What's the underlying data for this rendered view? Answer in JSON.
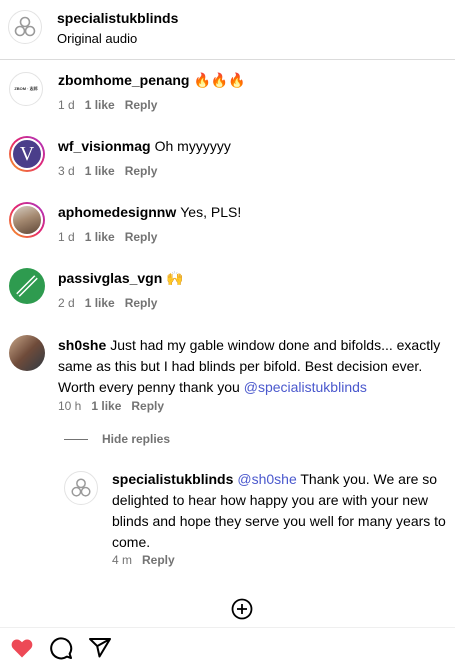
{
  "header": {
    "username": "specialistukblinds",
    "subtitle": "Original audio"
  },
  "comments": [
    {
      "username": "zbomhome_penang",
      "text": "🔥🔥🔥",
      "time": "1 d",
      "likes": "1 like",
      "reply": "Reply",
      "avatar_text": "ZBOM · 志邦"
    },
    {
      "username": "wf_visionmag",
      "text": "Oh myyyyyy",
      "time": "3 d",
      "likes": "1 like",
      "reply": "Reply",
      "avatar_text": "V"
    },
    {
      "username": "aphomedesignnw",
      "text": "Yes, PLS!",
      "time": "1 d",
      "likes": "1 like",
      "reply": "Reply"
    },
    {
      "username": "passivglas_vgn",
      "text": "🙌",
      "time": "2 d",
      "likes": "1 like",
      "reply": "Reply"
    },
    {
      "username": "sh0she",
      "text": "Just had my gable window done and bifolds... exactly same as this but I had blinds per bifold. Best decision ever. Worth every penny thank you",
      "mention": "@specialistukblinds",
      "time": "10 h",
      "likes": "1 like",
      "reply": "Reply"
    }
  ],
  "hide_replies": "Hide replies",
  "nested_reply": {
    "username": "specialistukblinds",
    "mention": "@sh0she",
    "text": "Thank you. We are so delighted to hear how happy you are with your new blinds and hope they serve you well for many years to come.",
    "time": "4 m",
    "reply": "Reply"
  },
  "colors": {
    "mention": "#4a58cd",
    "like_heart": "#ed4956",
    "meta_gray": "#737373"
  },
  "icons": [
    "logo-icon",
    "fire-icon",
    "raised-hands-icon",
    "add-circle-icon",
    "heart-icon",
    "comment-icon",
    "share-icon"
  ]
}
